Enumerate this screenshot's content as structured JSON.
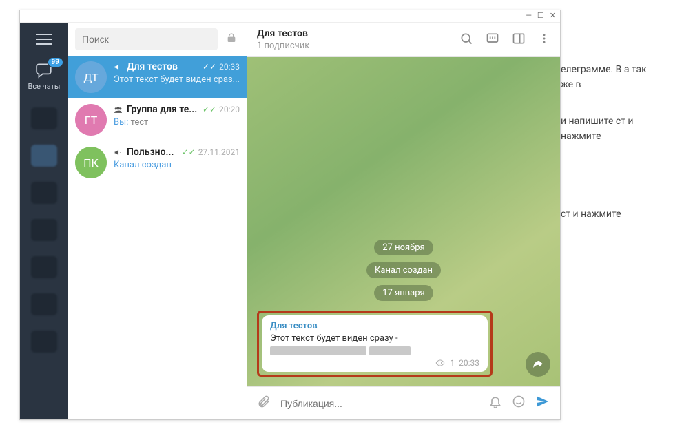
{
  "rail": {
    "all_chats_label": "Все чаты",
    "badge": "99"
  },
  "chatlist": {
    "search_placeholder": "Поиск",
    "you_prefix": "Вы: ",
    "items": [
      {
        "avatar": "ДТ",
        "av_bg": "#66a8dc",
        "icon": "megaphone",
        "title": "Для тестов",
        "time": "20:33",
        "preview": "Этот текст будет виден сраз...",
        "check": "double"
      },
      {
        "avatar": "ГТ",
        "av_bg": "#e07ab0",
        "icon": "group",
        "title": "Группа для те...",
        "time": "20:20",
        "preview": "тест",
        "check": "double",
        "you": true
      },
      {
        "avatar": "ПК",
        "av_bg": "#7fc15e",
        "icon": "megaphone",
        "title": "Пользно...",
        "time": "27.11.2021",
        "preview": "Канал создан",
        "check": "double",
        "preview_link": true
      }
    ]
  },
  "header": {
    "title": "Для тестов",
    "subtitle": "1 подписчик"
  },
  "messages": {
    "date1": "27 ноября",
    "service1": "Канал создан",
    "date2": "17 января",
    "msg": {
      "sender": "Для тестов",
      "text": "Этот текст будет виден сразу - ",
      "views": "1",
      "time": "20:33"
    }
  },
  "compose": {
    "placeholder": "Публикация..."
  },
  "bg_hints": {
    "p1": "елеграмме. В а так же в",
    "p2": "и напишите ст и нажмите",
    "p3": "ст и нажмите"
  }
}
